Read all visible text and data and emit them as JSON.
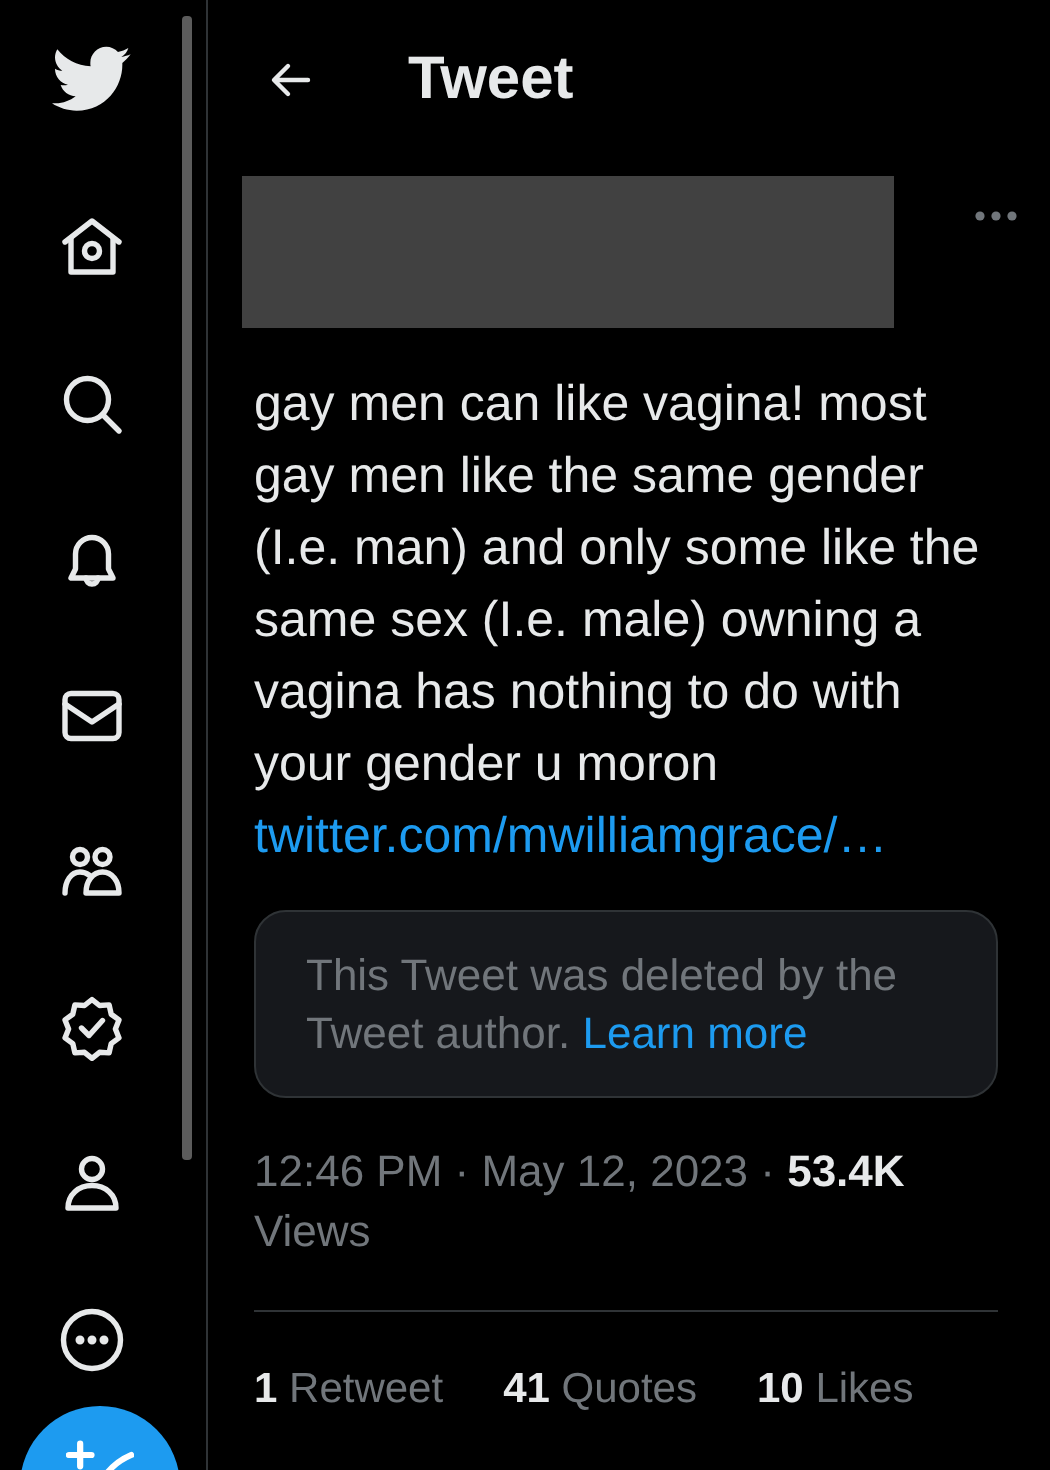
{
  "header": {
    "title": "Tweet"
  },
  "tweet": {
    "text": "gay men can like vagina! most gay men like the same gender (I.e. man) and only some like the same sex (I.e. male) owning a vagina has nothing to do with your gender u moron",
    "link": "twitter.com/mwilliamgrace/…",
    "quoted": {
      "text": "This Tweet was deleted by the Tweet author.",
      "link": "Learn more"
    },
    "meta": "12:46 PM · May 12, 2023 · **53.4K** Views",
    "stats": [
      {
        "count": "1",
        "label": "Retweet"
      },
      {
        "count": "41",
        "label": "Quotes"
      },
      {
        "count": "10",
        "label": "Likes"
      }
    ]
  }
}
